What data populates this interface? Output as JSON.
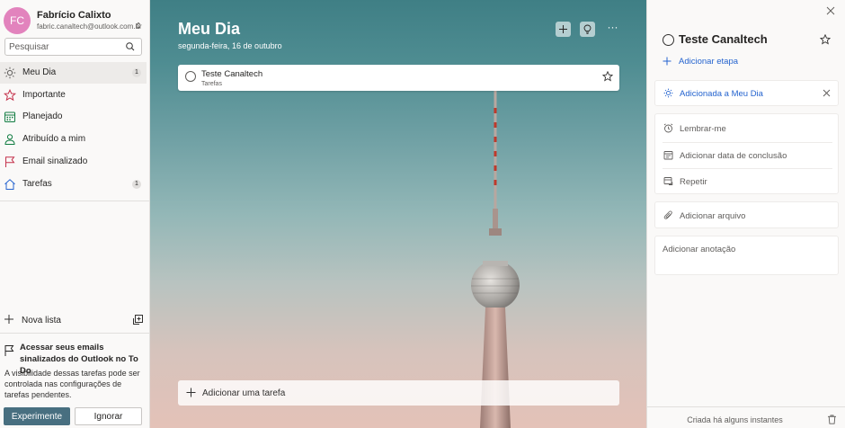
{
  "user": {
    "initials": "FC",
    "name": "Fabrício Calixto",
    "email": "fabric.canaltech@outlook.com.br"
  },
  "search": {
    "placeholder": "Pesquisar"
  },
  "sidebar": {
    "items": [
      {
        "label": "Meu Dia",
        "count": "1",
        "icon": "sun-icon"
      },
      {
        "label": "Importante",
        "count": "",
        "icon": "star-icon"
      },
      {
        "label": "Planejado",
        "count": "",
        "icon": "calendar-icon"
      },
      {
        "label": "Atribuído a mim",
        "count": "",
        "icon": "person-icon"
      },
      {
        "label": "Email sinalizado",
        "count": "",
        "icon": "flag-icon"
      },
      {
        "label": "Tarefas",
        "count": "1",
        "icon": "home-icon"
      }
    ],
    "new_list": "Nova lista"
  },
  "promo": {
    "title": "Acessar seus emails sinalizados do Outlook no To Do",
    "text": "A visibilidade dessas tarefas pode ser controlada nas configurações de tarefas pendentes.",
    "primary": "Experimente",
    "secondary": "Ignorar"
  },
  "main": {
    "title": "Meu Dia",
    "date": "segunda-feira, 16 de outubro",
    "more": "···",
    "task": {
      "title": "Teste Canaltech",
      "list": "Tarefas"
    },
    "add_task_placeholder": "Adicionar uma tarefa"
  },
  "detail": {
    "title": "Teste Canaltech",
    "add_step": "Adicionar etapa",
    "my_day": "Adicionada a Meu Dia",
    "remind": "Lembrar-me",
    "due": "Adicionar data de conclusão",
    "repeat": "Repetir",
    "attach": "Adicionar arquivo",
    "note_placeholder": "Adicionar anotação",
    "created": "Criada há alguns instantes"
  },
  "colors": {
    "accent": "#2564cf",
    "primary_button": "#486f80",
    "avatar": "#e283bd"
  }
}
